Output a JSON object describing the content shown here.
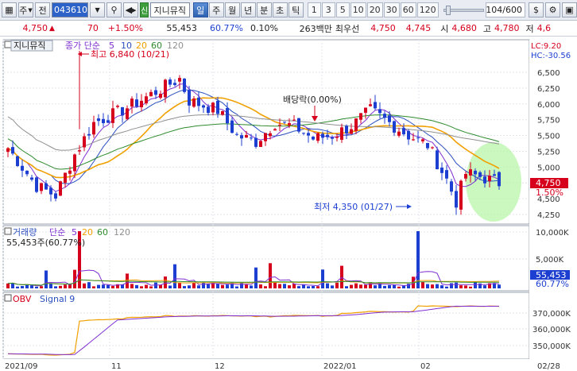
{
  "toolbar": {
    "market_selector": "주",
    "period_btn": "전",
    "stock_code": "043610",
    "stock_name": "지니뮤직",
    "sin_badge": "신",
    "tabs": [
      {
        "label": "일",
        "active": true
      },
      {
        "label": "주",
        "active": false
      },
      {
        "label": "월",
        "active": false
      },
      {
        "label": "년",
        "active": false
      },
      {
        "label": "분",
        "active": false
      },
      {
        "label": "초",
        "active": false
      },
      {
        "label": "틱",
        "active": false
      }
    ],
    "intervals": [
      "1",
      "3",
      "5",
      "10",
      "20",
      "30",
      "60",
      "120"
    ],
    "page_count": "104/600"
  },
  "infobar": {
    "price": "4,750",
    "change": "70",
    "change_pct": "+1.50%",
    "volume": "55,453",
    "vol_ratio": "60.77%",
    "turnover": "0.10%",
    "amount": "263백만",
    "bid_label": "최우선",
    "best_ask": "4,750",
    "best_bid": "4,745",
    "open_label": "시",
    "open": "4,680",
    "high_label": "고",
    "high": "4,780",
    "low_label": "저",
    "low": "4,6"
  },
  "price_panel": {
    "stock_label": "지니뮤직",
    "legend_title": "종가 단순",
    "ma_periods": [
      "5",
      "10",
      "20",
      "60",
      "120"
    ],
    "lc_label": "LC:9.20",
    "hc_label": "HC:-30.56",
    "y_ticks": [
      "6,500",
      "6,250",
      "6,000",
      "5,750",
      "5,500",
      "5,250",
      "5,000",
      "4,750",
      "4,500",
      "4,250"
    ],
    "max_annotation": "최고 6,840 (10/21)",
    "min_annotation": "최저 4,350 (01/27)",
    "dividend_annotation": "배당락(0.00%)",
    "current_price_tag": "4,750",
    "current_pct_tag": "1.50%"
  },
  "volume_panel": {
    "title": "거래량",
    "legend_title": "단순",
    "ma_periods": [
      "5",
      "20",
      "60",
      "120"
    ],
    "current_info": "55,453주(60.77%)",
    "y_ticks": [
      "10,000K",
      "5,000K"
    ],
    "current_tag": "55,453",
    "current_pct_tag": "60.77%"
  },
  "obv_panel": {
    "title": "OBV",
    "signal_label": "Signal 9",
    "y_ticks": [
      "370,000K",
      "360,000K",
      "350,000K"
    ]
  },
  "x_axis": {
    "labels": [
      "2021/09",
      "11",
      "12",
      "2022/01",
      "02"
    ],
    "right_label": "02/28"
  },
  "colors": {
    "up": "#d6001c",
    "down": "#1d3fd1",
    "ma5": "#7f2fd1",
    "ma10": "#2a4fbf",
    "ma20": "#f0a000",
    "ma60": "#2e8b2e",
    "ma120": "#909090",
    "highlight": "#b8f5a8"
  }
}
